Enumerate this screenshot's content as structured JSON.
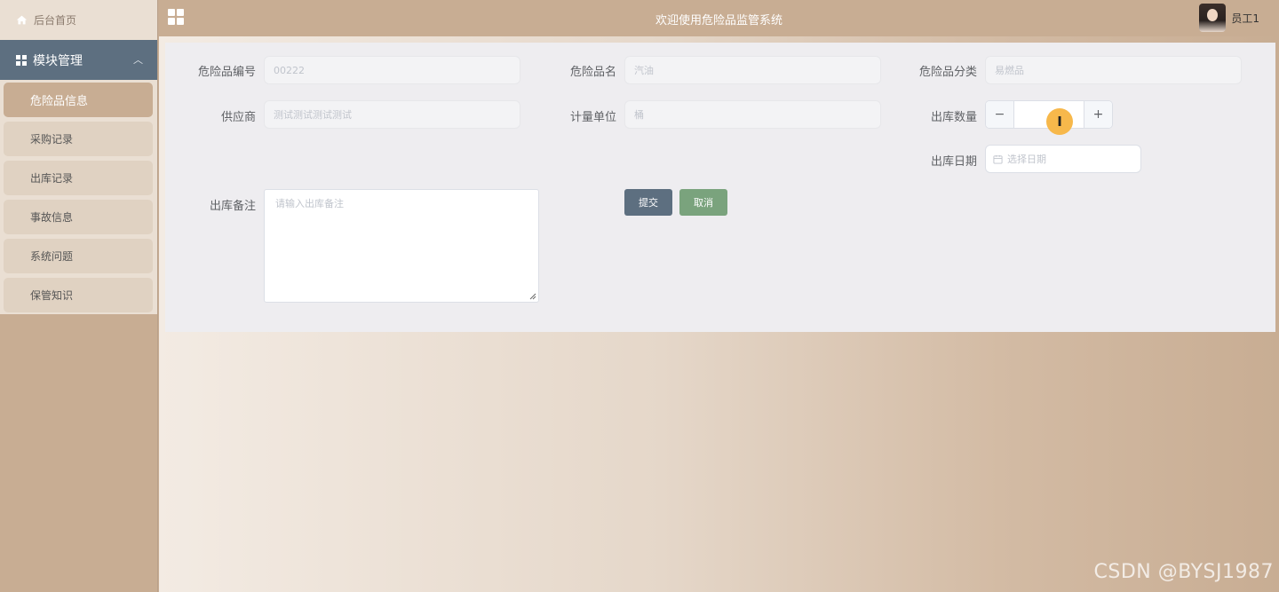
{
  "sidebar": {
    "home_label": "后台首页",
    "module_label": "模块管理",
    "items": [
      {
        "label": "危险品信息",
        "active": true
      },
      {
        "label": "采购记录"
      },
      {
        "label": "出库记录"
      },
      {
        "label": "事故信息"
      },
      {
        "label": "系统问题"
      },
      {
        "label": "保管知识"
      }
    ]
  },
  "header": {
    "title": "欢迎使用危险品监管系统",
    "user_name": "员工1"
  },
  "form": {
    "code": {
      "label": "危险品编号",
      "value": "00222"
    },
    "name": {
      "label": "危险品名",
      "value": "汽油"
    },
    "category": {
      "label": "危险品分类",
      "value": "易燃品"
    },
    "supplier": {
      "label": "供应商",
      "value": "测试测试测试测试"
    },
    "unit": {
      "label": "计量单位",
      "value": "桶"
    },
    "quantity": {
      "label": "出库数量",
      "minus": "−",
      "plus": "+",
      "value": ""
    },
    "date": {
      "label": "出库日期",
      "placeholder": "选择日期"
    },
    "remark": {
      "label": "出库备注",
      "placeholder": "请输入出库备注"
    },
    "submit_label": "提交",
    "cancel_label": "取消"
  },
  "cursor_glyph": "I",
  "watermark": "CSDN @BYSJ1987",
  "colors": {
    "sidebar_bg": "#c8ad93",
    "module_header": "#5d6f80",
    "submit": "#5d6f80",
    "cancel": "#7aa37d",
    "cursor": "#f7b84b"
  }
}
